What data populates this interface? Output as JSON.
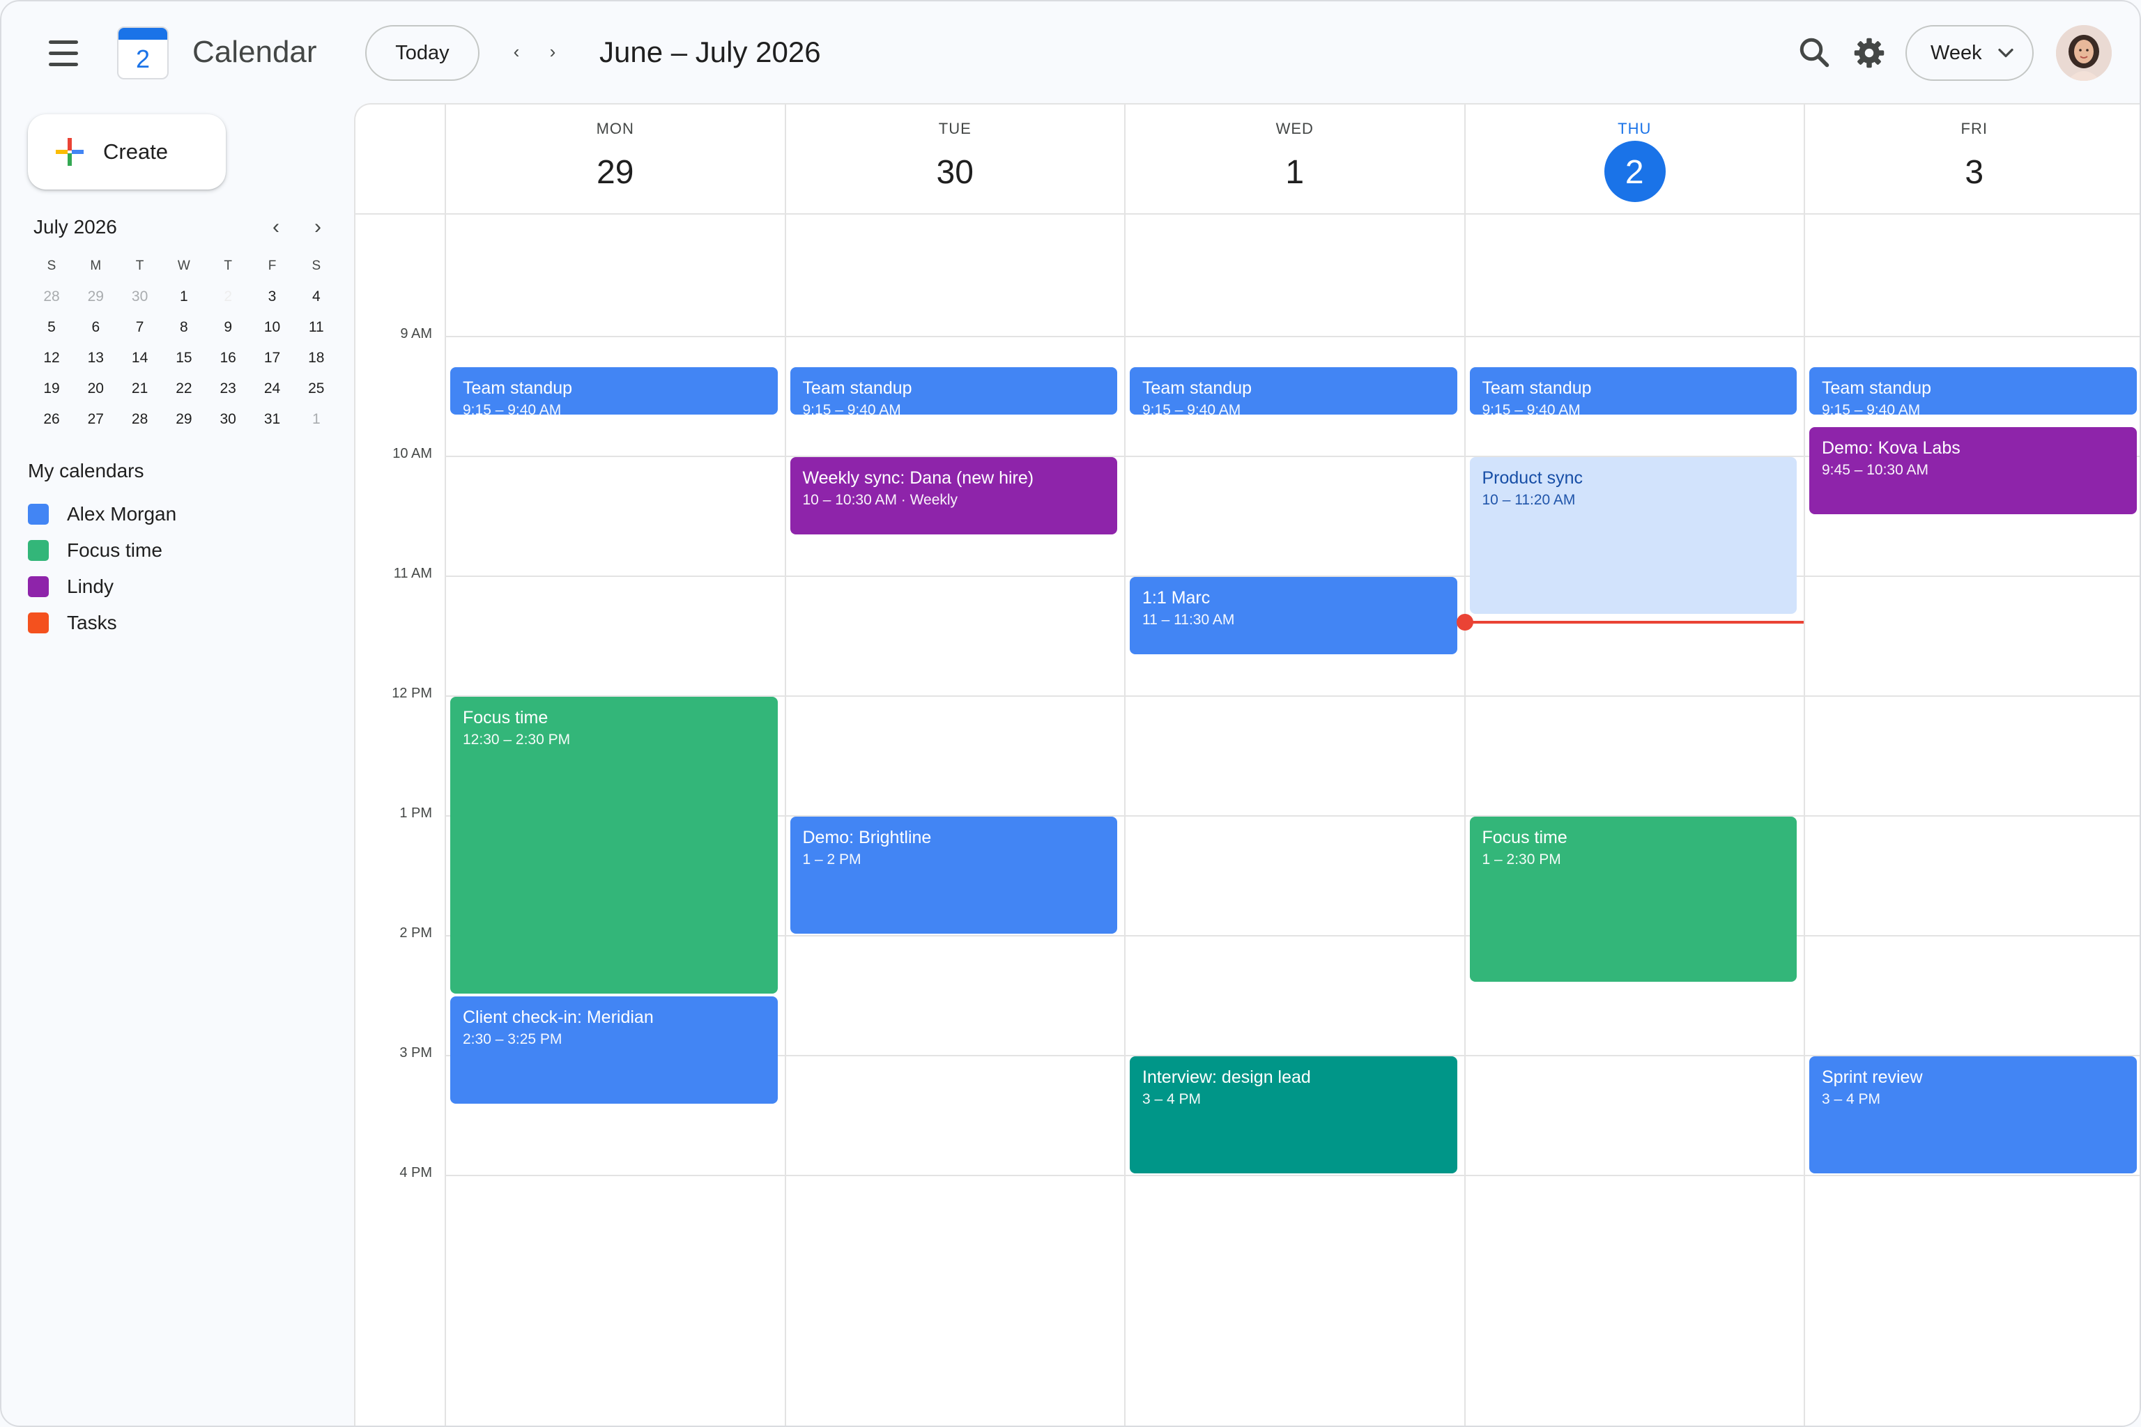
{
  "header": {
    "app_title": "Calendar",
    "logo_day": "2",
    "today_label": "Today",
    "prev_label": "‹",
    "next_label": "›",
    "date_range": "June – July 2026",
    "view_label": "Week"
  },
  "sidebar": {
    "create_label": "Create",
    "mini_calendar": {
      "title": "July 2026",
      "weekdays": [
        "S",
        "M",
        "T",
        "W",
        "T",
        "F",
        "S"
      ],
      "weeks": [
        [
          "28",
          "29",
          "30",
          "1",
          "2",
          "3",
          "4"
        ],
        [
          "5",
          "6",
          "7",
          "8",
          "9",
          "10",
          "11"
        ],
        [
          "12",
          "13",
          "14",
          "15",
          "16",
          "17",
          "18"
        ],
        [
          "19",
          "20",
          "21",
          "22",
          "23",
          "24",
          "25"
        ],
        [
          "26",
          "27",
          "28",
          "29",
          "30",
          "31",
          "1"
        ]
      ]
    },
    "my_calendars_title": "My calendars",
    "calendars": [
      {
        "name": "Alex Morgan",
        "color": "#4285f4"
      },
      {
        "name": "Focus time",
        "color": "#33b679"
      },
      {
        "name": "Lindy",
        "color": "#8e24aa"
      },
      {
        "name": "Tasks",
        "color": "#f4511e"
      }
    ]
  },
  "week": {
    "days": [
      {
        "dow": "MON",
        "dom": "29"
      },
      {
        "dow": "TUE",
        "dom": "30"
      },
      {
        "dow": "WED",
        "dom": "1"
      },
      {
        "dow": "THU",
        "dom": "2",
        "today": true
      },
      {
        "dow": "FRI",
        "dom": "3"
      }
    ],
    "hours": [
      "9 AM",
      "10 AM",
      "11 AM",
      "12 PM",
      "1 PM",
      "2 PM",
      "3 PM",
      "4 PM"
    ],
    "now_time": "11:20 AM",
    "events": [
      {
        "day": 0,
        "title": "Team standup",
        "time": "9:15 – 9:40 AM",
        "start": 9.25,
        "end": 9.6667,
        "color": "blue"
      },
      {
        "day": 1,
        "title": "Team standup",
        "time": "9:15 – 9:40 AM",
        "start": 9.25,
        "end": 9.6667,
        "color": "blue"
      },
      {
        "day": 2,
        "title": "Team standup",
        "time": "9:15 – 9:40 AM",
        "start": 9.25,
        "end": 9.6667,
        "color": "blue"
      },
      {
        "day": 3,
        "title": "Team standup",
        "time": "9:15 – 9:40 AM",
        "start": 9.25,
        "end": 9.6667,
        "color": "blue"
      },
      {
        "day": 4,
        "title": "Team standup",
        "time": "9:15 – 9:40 AM",
        "start": 9.25,
        "end": 9.6667,
        "color": "blue"
      },
      {
        "day": 4,
        "title": "Demo: Kova Labs",
        "time": "9:45 – 10:30 AM",
        "start": 9.75,
        "end": 10.5,
        "color": "purple"
      },
      {
        "day": 1,
        "title": "Weekly sync: Dana (new hire)",
        "time": "10 – 10:30 AM · Weekly",
        "start": 10,
        "end": 10.6667,
        "color": "purple"
      },
      {
        "day": 3,
        "title": "Product sync",
        "time": "10 – 11:20 AM",
        "start": 10,
        "end": 11.3333,
        "color": "light"
      },
      {
        "day": 2,
        "title": "1:1 Marc",
        "time": "11 – 11:30 AM",
        "start": 11,
        "end": 11.6667,
        "color": "blue"
      },
      {
        "day": 0,
        "title": "Focus time",
        "time": "12:30 – 2:30 PM",
        "start": 12,
        "end": 14.5,
        "color": "green"
      },
      {
        "day": 1,
        "title": "Demo: Brightline",
        "time": "1 – 2 PM",
        "start": 13,
        "end": 14,
        "color": "blue"
      },
      {
        "day": 3,
        "title": "Focus time",
        "time": "1 – 2:30 PM",
        "start": 13,
        "end": 14.4,
        "color": "green"
      },
      {
        "day": 0,
        "title": "Client check-in: Meridian",
        "time": "2:30 – 3:25 PM",
        "start": 14.5,
        "end": 15.4167,
        "color": "blue"
      },
      {
        "day": 2,
        "title": "Interview: design lead",
        "time": "3 – 4 PM",
        "start": 15,
        "end": 16,
        "color": "teal"
      },
      {
        "day": 4,
        "title": "Sprint review",
        "time": "3 – 4 PM",
        "start": 15,
        "end": 16,
        "color": "blue"
      }
    ]
  }
}
